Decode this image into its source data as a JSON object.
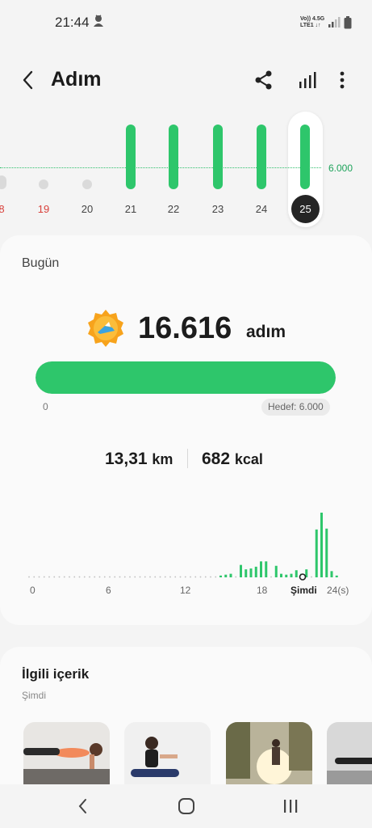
{
  "status_bar": {
    "time": "21:44",
    "net_line1": "Vo)) 4.5G",
    "net_line2": "LTE1 ↓↑"
  },
  "app_bar": {
    "title": "Adım",
    "back_icon": "back-arrow-icon",
    "actions": [
      "share-icon",
      "bar-chart-icon",
      "more-vert-icon"
    ]
  },
  "week_chart": {
    "goal_label": "6.000",
    "days": [
      {
        "label": "8",
        "value": 3800,
        "weekend": true
      },
      {
        "label": "19",
        "value": 2200,
        "weekend": true
      },
      {
        "label": "20",
        "value": 1200,
        "weekend": false
      },
      {
        "label": "21",
        "value": 8900,
        "weekend": false
      },
      {
        "label": "22",
        "value": 11200,
        "weekend": false
      },
      {
        "label": "23",
        "value": 12000,
        "weekend": false
      },
      {
        "label": "24",
        "value": 10600,
        "weekend": false
      },
      {
        "label": "25",
        "value": 12500,
        "weekend": false,
        "selected": true
      }
    ]
  },
  "today": {
    "label": "Bugün",
    "steps": "16.616",
    "steps_unit": "adım",
    "progress_fraction": 1.0,
    "progress_min": "0",
    "goal_text": "Hedef: 6.000",
    "distance_value": "13,31",
    "distance_unit": "km",
    "calories_value": "682",
    "calories_unit": "kcal",
    "hourly_axis": [
      "0",
      "6",
      "12",
      "18",
      "Şimdi",
      "24(s)"
    ],
    "hourly_steps": [
      0,
      0,
      0,
      0,
      0,
      0,
      0,
      0,
      0,
      0,
      0,
      0,
      0,
      0,
      0,
      0,
      0,
      0,
      0,
      0,
      0,
      0,
      0,
      0,
      0,
      0,
      0,
      0,
      0,
      0,
      0,
      0,
      0,
      0,
      0,
      0,
      0,
      0,
      40,
      60,
      80,
      0,
      280,
      180,
      200,
      240,
      360,
      360,
      0,
      260,
      80,
      60,
      80,
      160,
      80,
      180,
      0,
      1080,
      1460,
      1100,
      140,
      40
    ]
  },
  "related": {
    "title": "İlgili içerik",
    "subtitle": "Şimdi"
  },
  "colors": {
    "accent": "#2ec66b",
    "inactive_bar": "#dadada",
    "weekend_day": "#d9413b"
  },
  "nav_bar": [
    "nav-back-icon",
    "nav-home-icon",
    "nav-recents-icon"
  ]
}
